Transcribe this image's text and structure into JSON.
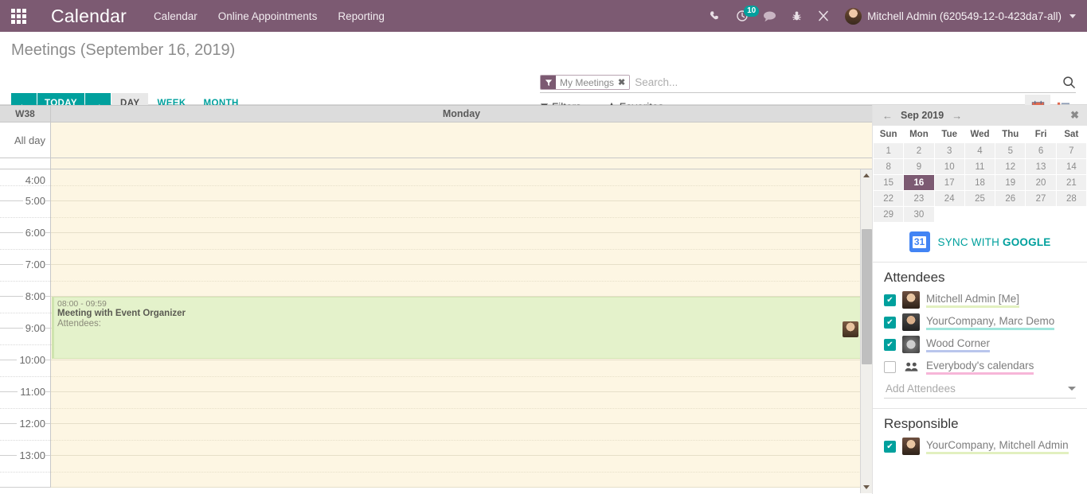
{
  "navbar": {
    "apps_icon": "apps-grid-icon",
    "brand": "Calendar",
    "menu": [
      {
        "label": "Calendar"
      },
      {
        "label": "Online Appointments"
      },
      {
        "label": "Reporting"
      }
    ],
    "icons": [
      {
        "name": "phone-icon",
        "glyph": "☎"
      },
      {
        "name": "activity-clock-icon",
        "glyph": "◴",
        "badge": "10"
      },
      {
        "name": "messages-icon",
        "glyph": "💬"
      },
      {
        "name": "bug-icon",
        "glyph": "🐞"
      },
      {
        "name": "developer-tools-icon",
        "glyph": "⚒"
      }
    ],
    "user": "Mitchell Admin (620549-12-0-423da7-all)"
  },
  "control_panel": {
    "title": "Meetings (September 16, 2019)",
    "prev_label": "←",
    "today_label": "TODAY",
    "next_label": "→",
    "scales": [
      {
        "label": "DAY",
        "active": true
      },
      {
        "label": "WEEK",
        "active": false
      },
      {
        "label": "MONTH",
        "active": false
      }
    ],
    "search": {
      "facet_label": "My Meetings",
      "facet_remove": "✖",
      "placeholder": "Search..."
    },
    "filters_label": "Filters",
    "favorites_label": "Favorites",
    "views": [
      {
        "name": "calendar-view",
        "active": true
      },
      {
        "name": "list-view",
        "active": false
      }
    ]
  },
  "calendar": {
    "week_label": "W38",
    "day_label": "Monday",
    "allday_label": "All day",
    "hours": [
      "4:00",
      "5:00",
      "6:00",
      "7:00",
      "8:00",
      "9:00",
      "10:00",
      "11:00",
      "12:00",
      "13:00"
    ],
    "event": {
      "time": "08:00 - 09:59",
      "title": "Meeting with Event Organizer",
      "attendees_label": "Attendees:"
    }
  },
  "sidebar": {
    "mini_calendar": {
      "prev": "←",
      "title": "Sep 2019",
      "next": "→",
      "close": "✖",
      "weekdays": [
        "Sun",
        "Mon",
        "Tue",
        "Wed",
        "Thu",
        "Fri",
        "Sat"
      ],
      "weeks": [
        [
          "1",
          "2",
          "3",
          "4",
          "5",
          "6",
          "7"
        ],
        [
          "8",
          "9",
          "10",
          "11",
          "12",
          "13",
          "14"
        ],
        [
          "15",
          "16",
          "17",
          "18",
          "19",
          "20",
          "21"
        ],
        [
          "22",
          "23",
          "24",
          "25",
          "26",
          "27",
          "28"
        ],
        [
          "29",
          "30",
          "",
          "",
          "",
          "",
          ""
        ]
      ],
      "selected_day": "16"
    },
    "sync": {
      "icon_text": "31",
      "label_light": "SYNC WITH ",
      "label_bold": "GOOGLE"
    },
    "attendees_title": "Attendees",
    "attendees": [
      {
        "name": "Mitchell Admin [Me]",
        "checked": true,
        "color": "#e2f0c0",
        "avatar": "av-a"
      },
      {
        "name": "YourCompany, Marc Demo",
        "checked": true,
        "color": "#9fe6dc",
        "avatar": "av-b"
      },
      {
        "name": "Wood Corner",
        "checked": true,
        "color": "#b9c6ec",
        "avatar": "av-c"
      },
      {
        "name": "Everybody's calendars",
        "checked": false,
        "color": "#f7b6d8",
        "avatar": "group"
      }
    ],
    "add_attendees_placeholder": "Add Attendees",
    "responsible_title": "Responsible",
    "responsible": [
      {
        "name": "YourCompany, Mitchell Admin",
        "checked": true,
        "color": "#e2f0c0",
        "avatar": "av-a"
      }
    ]
  },
  "colors": {
    "brand_purple": "#7c5a72",
    "teal": "#00a09d",
    "business_hours": "#fdf6e3",
    "event_green": "#e4f2cb"
  }
}
